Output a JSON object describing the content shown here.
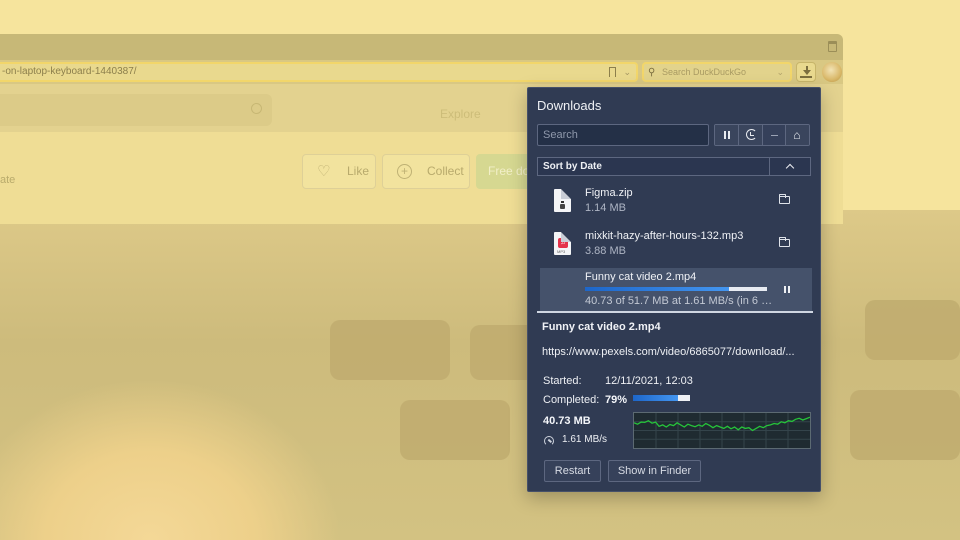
{
  "browser": {
    "address_text": "-on-laptop-keyboard-1440387/",
    "search_placeholder": "Search DuckDuckGo"
  },
  "page": {
    "explore": "Explore",
    "like_label": "Like",
    "collect_label": "Collect",
    "free_download_label": "Free do",
    "left_text": "ate"
  },
  "downloads": {
    "title": "Downloads",
    "search_placeholder": "Search",
    "sort_label": "Sort by Date",
    "items": [
      {
        "name": "Figma.zip",
        "size": "1.14 MB"
      },
      {
        "name": "mixkit-hazy-after-hours-132.mp3",
        "size": "3.88 MB"
      },
      {
        "name": "Funny cat video 2.mp4",
        "progress_text": "40.73 of 51.7 MB at 1.61 MB/s (in 6 …",
        "progress": 0.79
      }
    ],
    "detail": {
      "title": "Funny cat video 2.mp4",
      "url": "https://www.pexels.com/video/6865077/download/...",
      "started_label": "Started:",
      "started_value": "12/11/2021, 12:03",
      "completed_label": "Completed:",
      "completed_value": "79%",
      "completed_fraction": 0.79,
      "downloaded": "40.73 MB",
      "speed": "1.61 MB/s",
      "speed_history": [
        0.72,
        0.68,
        0.74,
        0.73,
        0.78,
        0.71,
        0.74,
        0.62,
        0.66,
        0.6,
        0.67,
        0.64,
        0.72,
        0.66,
        0.6,
        0.68,
        0.64,
        0.61,
        0.66,
        0.62,
        0.7,
        0.65,
        0.58,
        0.64,
        0.6,
        0.56,
        0.62,
        0.55,
        0.6,
        0.52,
        0.6,
        0.56,
        0.58,
        0.5,
        0.56,
        0.62,
        0.58,
        0.64,
        0.66,
        0.7,
        0.68,
        0.75,
        0.72,
        0.78,
        0.76,
        0.82,
        0.85,
        0.8,
        0.84,
        0.88
      ]
    },
    "restart_label": "Restart",
    "finder_label": "Show in Finder"
  },
  "colors": {
    "panel_bg": "#303b53",
    "progress_blue": "#2f7fe0",
    "graph_line": "#26c43a",
    "tint_yellow": "#f6e49d"
  }
}
